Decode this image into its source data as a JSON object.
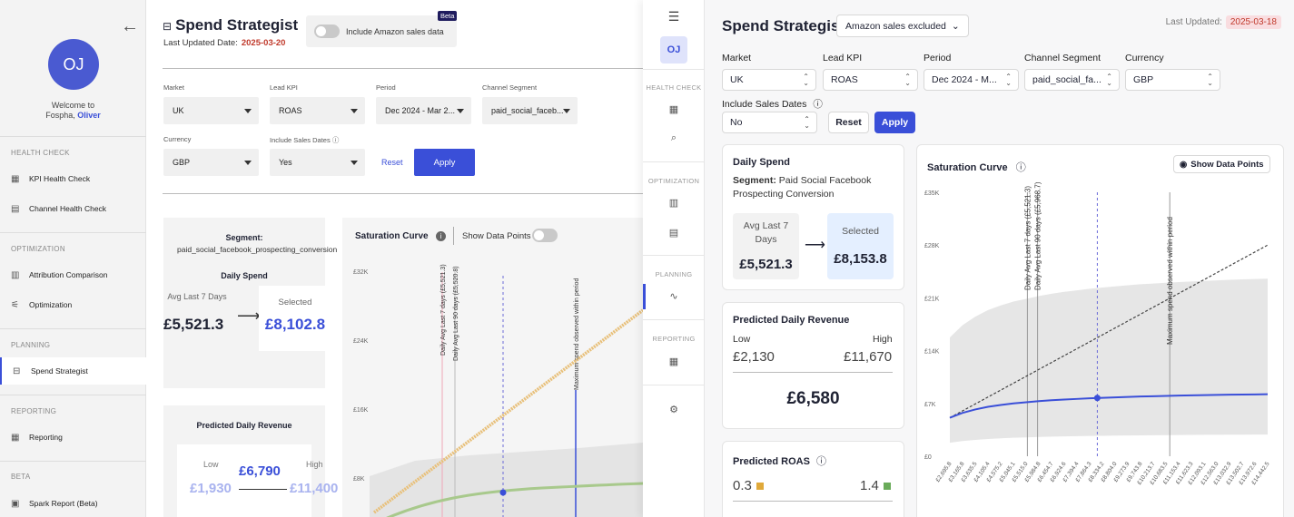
{
  "old_ui": {
    "sidebar": {
      "avatar": "OJ",
      "welcome": "Welcome to",
      "welcome_line2": "Fospha,",
      "user": "Oliver",
      "sections": [
        {
          "label": "HEALTH CHECK",
          "items": [
            {
              "label": "KPI Health Check",
              "icon": "grid-icon"
            },
            {
              "label": "Channel Health Check",
              "icon": "table-icon"
            }
          ]
        },
        {
          "label": "OPTIMIZATION",
          "items": [
            {
              "label": "Attribution Comparison",
              "icon": "bar-chart-icon"
            },
            {
              "label": "Optimization",
              "icon": "sliders-icon"
            }
          ]
        },
        {
          "label": "PLANNING",
          "items": [
            {
              "label": "Spend Strategist",
              "icon": "strategist-icon"
            }
          ]
        },
        {
          "label": "REPORTING",
          "items": [
            {
              "label": "Reporting",
              "icon": "table-icon"
            }
          ]
        },
        {
          "label": "BETA",
          "items": [
            {
              "label": "Spark Report (Beta)",
              "icon": "report-icon"
            }
          ]
        }
      ]
    },
    "header": {
      "title": "Spend Strategist",
      "last_updated_label": "Last Updated Date:",
      "last_updated": "2025-03-20",
      "toggle_label": "Include Amazon sales data",
      "beta": "Beta"
    },
    "filters": {
      "market_label": "Market",
      "market": "UK",
      "kpi_label": "Lead KPI",
      "kpi": "ROAS",
      "period_label": "Period",
      "period": "Dec 2024 - Mar 2...",
      "channel_label": "Channel Segment",
      "channel": "paid_social_faceb...",
      "currency_label": "Currency",
      "currency": "GBP",
      "sales_dates_label": "Include Sales Dates",
      "sales_dates": "Yes",
      "reset": "Reset",
      "apply": "Apply"
    },
    "segment_card": {
      "segment_label": "Segment:",
      "segment": "paid_social_facebook_prospecting_conversion",
      "daily_spend": "Daily Spend",
      "avg_label": "Avg Last 7 Days",
      "avg": "£5,521.3",
      "selected_label": "Selected",
      "selected": "£8,102.8"
    },
    "revenue_card": {
      "title": "Predicted Daily Revenue",
      "low_label": "Low",
      "high_label": "High",
      "mid": "£6,790",
      "low": "£1,930",
      "high": "£11,400"
    },
    "chart_header": {
      "title": "Saturation Curve",
      "show_points": "Show Data Points"
    }
  },
  "new_ui": {
    "rail": {
      "avatar": "OJ",
      "sections": [
        "HEALTH CHECK",
        "OPTIMIZATION",
        "PLANNING",
        "REPORTING"
      ]
    },
    "header": {
      "title": "Spend Strategist",
      "amazon": "Amazon sales excluded",
      "last_updated_label": "Last Updated:",
      "last_updated": "2025-03-18"
    },
    "filters": {
      "market_label": "Market",
      "market": "UK",
      "kpi_label": "Lead KPI",
      "kpi": "ROAS",
      "period_label": "Period",
      "period": "Dec 2024 - M...",
      "channel_label": "Channel Segment",
      "channel": "paid_social_fa...",
      "currency_label": "Currency",
      "currency": "GBP",
      "sales_dates_label": "Include Sales Dates",
      "sales_dates": "No",
      "reset": "Reset",
      "apply": "Apply"
    },
    "daily_spend": {
      "title": "Daily Spend",
      "segment_label": "Segment:",
      "segment": "Paid Social Facebook Prospecting Conversion",
      "avg_label": "Avg Last 7 Days",
      "avg": "£5,521.3",
      "selected_label": "Selected",
      "selected": "£8,153.8"
    },
    "revenue": {
      "title": "Predicted Daily Revenue",
      "low_label": "Low",
      "high_label": "High",
      "low": "£2,130",
      "high": "£11,670",
      "mid": "£6,580"
    },
    "roas": {
      "title": "Predicted ROAS",
      "low": "0.3",
      "high": "1.4",
      "low_color": "#e0a93a",
      "high_color": "#6aab5a"
    },
    "chart_header": {
      "title": "Saturation Curve",
      "show_points": "Show Data Points"
    }
  },
  "chart_data": [
    {
      "type": "line",
      "title": "Saturation Curve",
      "y_ticks": [
        "£32K",
        "£24K",
        "£16K",
        "£8K"
      ],
      "ylim": [
        0,
        32000
      ],
      "annotations": [
        {
          "label": "Daily Avg Last 7 days (£5,521.3)"
        },
        {
          "label": "Daily Avg Last 90 days (£5,520.8)"
        },
        {
          "label": "Maximum spend observed within period"
        }
      ],
      "series": [
        {
          "name": "",
          "color": "#e8c07a"
        },
        {
          "name": "",
          "color": "#a8c98c"
        }
      ]
    },
    {
      "type": "line",
      "title": "Saturation Curve",
      "y_ticks": [
        "£35K",
        "£28K",
        "£21K",
        "£14K",
        "£7K",
        "£0"
      ],
      "ylim": [
        0,
        35000
      ],
      "x": [
        "£2,695.8",
        "£3,165.8",
        "£3,635.5",
        "£4,105.4",
        "£4,575.2",
        "£5,045.1",
        "£5,515.0",
        "£5,984.8",
        "£6,454.7",
        "£6,924.6",
        "£7,394.4",
        "£7,864.3",
        "£8,334.2",
        "£8,804.0",
        "£9,273.9",
        "£9,743.8",
        "£10,213.7",
        "£10,683.5",
        "£11,153.4",
        "£11,623.3",
        "£12,093.1",
        "£12,563.0",
        "£13,032.9",
        "£13,502.7",
        "£13,972.6",
        "£14,442.5"
      ],
      "revenue_curve": [
        5100,
        5750,
        6200,
        6550,
        6800,
        7000,
        7150,
        7300,
        7420,
        7520,
        7600,
        7680,
        7750,
        7810,
        7870,
        7920,
        7960,
        8000,
        8040,
        8070,
        8100,
        8130,
        8160,
        8180,
        8200,
        8220
      ],
      "breakeven_line_start": 5100,
      "breakeven_line_end": 28000,
      "selected_point": {
        "x": "£8,153.8",
        "y": 7730
      },
      "annotations": [
        {
          "label": "Daily Avg Last 7 days (£5,521.3)"
        },
        {
          "label": "Daily Avg Last 90 days (£5,968.7)"
        },
        {
          "label": "Maximum spend observed within period"
        }
      ]
    }
  ]
}
